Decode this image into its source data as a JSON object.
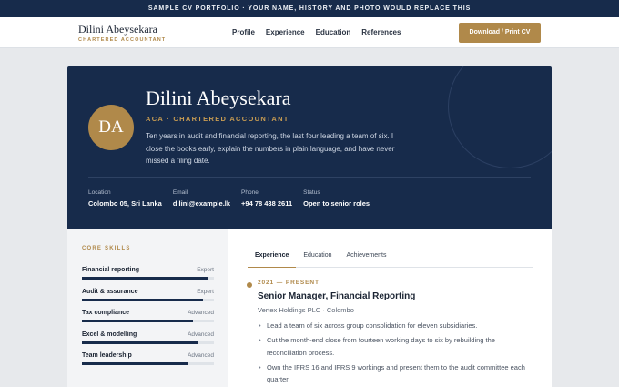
{
  "banner": {
    "text": "SAMPLE CV PORTFOLIO · YOUR NAME, HISTORY AND PHOTO WOULD REPLACE THIS"
  },
  "nav": {
    "brand_name": "Dilini Abeysekara",
    "brand_sub": "CHARTERED ACCOUNTANT",
    "links": [
      "Profile",
      "Experience",
      "Education",
      "References"
    ],
    "cta": "Download / Print CV"
  },
  "hero": {
    "initials": "DA",
    "name": "Dilini Abeysekara",
    "title": "ACA · CHARTERED ACCOUNTANT",
    "summary": "Ten years in audit and financial reporting, the last four leading a team of six. I close the books early, explain the numbers in plain language, and have never missed a filing date.",
    "facts": [
      {
        "label": "Location",
        "value": "Colombo 05, Sri Lanka"
      },
      {
        "label": "Email",
        "value": "dilini@example.lk"
      },
      {
        "label": "Phone",
        "value": "+94 78 438 2611"
      },
      {
        "label": "Status",
        "value": "Open to senior roles"
      }
    ]
  },
  "sidebar": {
    "heading": "CORE SKILLS",
    "skills": [
      {
        "name": "Financial reporting",
        "level": "Expert",
        "proficiency": 0.96
      },
      {
        "name": "Audit & assurance",
        "level": "Expert",
        "proficiency": 0.92
      },
      {
        "name": "Tax compliance",
        "level": "Advanced",
        "proficiency": 0.84
      },
      {
        "name": "Excel & modelling",
        "level": "Advanced",
        "proficiency": 0.88
      },
      {
        "name": "Team leadership",
        "level": "Advanced",
        "proficiency": 0.8
      }
    ]
  },
  "main": {
    "tabs": [
      "Experience",
      "Education",
      "Achievements"
    ],
    "active_tab": "Experience",
    "job": {
      "date": "2021 — PRESENT",
      "title": "Senior Manager, Financial Reporting",
      "company": "Vertex Holdings PLC · Colombo",
      "bullets": [
        "Lead a team of six across group consolidation for eleven subsidiaries.",
        "Cut the month-end close from fourteen working days to six by rebuilding the reconciliation process.",
        "Own the IFRS 16 and IFRS 9 workings and present them to the audit committee each quarter."
      ]
    }
  },
  "colors": {
    "navy": "#172b4b",
    "gold": "#b0894a",
    "background": "#e7e9ec"
  }
}
